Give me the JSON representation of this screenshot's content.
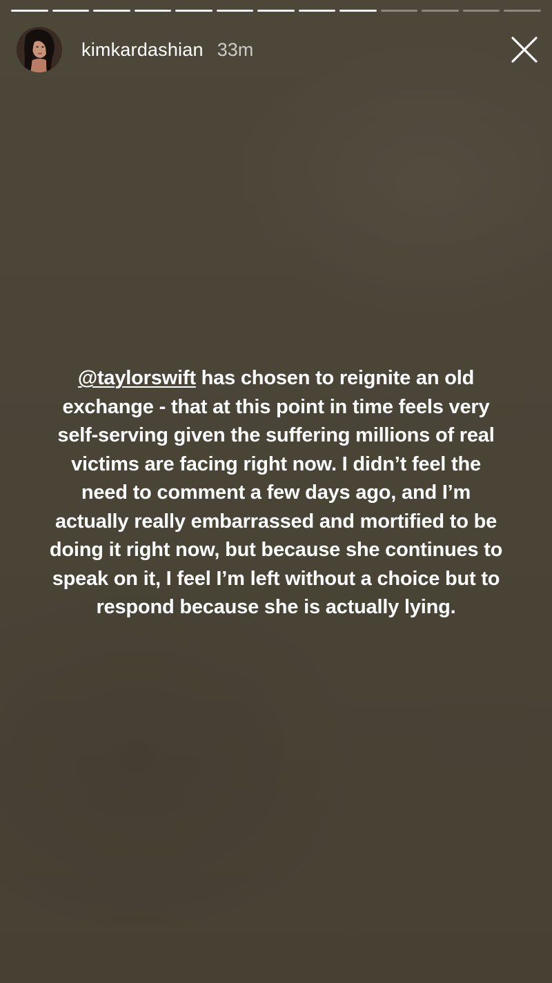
{
  "story": {
    "progress": {
      "segments_total": 13,
      "segments_seen": 9
    },
    "header": {
      "username": "kimkardashian",
      "timestamp": "33m",
      "avatar_icon": "profile-photo",
      "close_icon": "close-x-icon"
    },
    "text": {
      "mention": "@taylorswift",
      "lines": [
        " has chosen to reignite an old",
        "exchange - that at this point in time feels very",
        "self-serving given the suffering millions of real",
        "victims are facing right now. I didn’t feel the",
        "need to comment a few days ago, and I’m",
        "actually really embarrassed and mortified to be",
        "doing it right now, but because she continues to",
        "speak on it, I feel I’m left without a choice but to",
        "respond because she is actually lying."
      ]
    },
    "colors": {
      "background": "#4a4437",
      "text": "#ffffff"
    }
  }
}
